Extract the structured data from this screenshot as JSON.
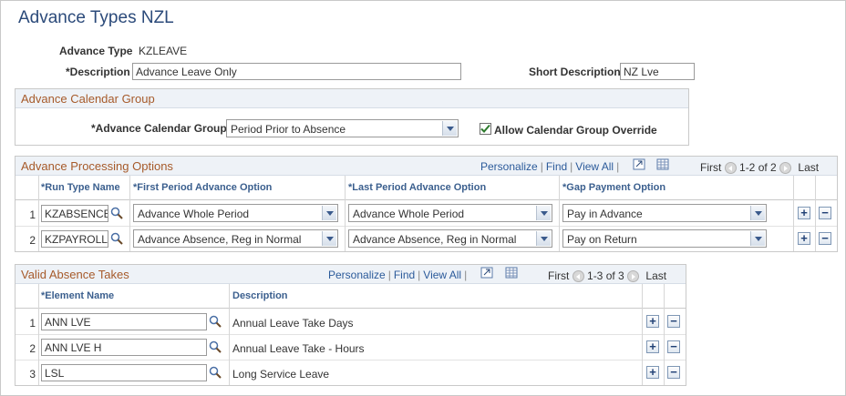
{
  "page": {
    "title": "Advance Types NZL"
  },
  "header": {
    "advance_type_label": "Advance Type",
    "advance_type_value": "KZLEAVE",
    "description_label": "*Description",
    "description_value": "Advance Leave Only",
    "short_description_label": "Short Description",
    "short_description_value": "NZ Lve"
  },
  "calendar_group": {
    "section_title": "Advance Calendar Group",
    "field_label": "*Advance Calendar Group",
    "selected": "Period Prior to Absence",
    "override_label": "Allow Calendar Group Override",
    "override_checked": true
  },
  "processing": {
    "section_title": "Advance Processing Options",
    "nav": {
      "personalize": "Personalize",
      "find": "Find",
      "view_all": "View All",
      "first": "First",
      "range": "1-2 of 2",
      "last": "Last"
    },
    "columns": {
      "run_type": "*Run Type Name",
      "first_period": "*First Period Advance Option",
      "last_period": "*Last Period Advance Option",
      "gap_payment": "*Gap Payment Option"
    },
    "rows": [
      {
        "num": "1",
        "run_type": "KZABSENCE",
        "first_period": "Advance Whole Period",
        "last_period": "Advance Whole Period",
        "gap_payment": "Pay in Advance"
      },
      {
        "num": "2",
        "run_type": "KZPAYROLL",
        "first_period": "Advance Absence, Reg in Normal",
        "last_period": "Advance Absence, Reg in Normal",
        "gap_payment": "Pay on Return"
      }
    ]
  },
  "absence_takes": {
    "section_title": "Valid Absence Takes",
    "nav": {
      "personalize": "Personalize",
      "find": "Find",
      "view_all": "View All",
      "first": "First",
      "range": "1-3 of 3",
      "last": "Last"
    },
    "columns": {
      "element_name": "*Element Name",
      "description": "Description"
    },
    "rows": [
      {
        "num": "1",
        "element_name": "ANN LVE",
        "description": "Annual Leave Take Days"
      },
      {
        "num": "2",
        "element_name": "ANN LVE H",
        "description": "Annual Leave Take - Hours"
      },
      {
        "num": "3",
        "element_name": "LSL",
        "description": "Long Service Leave"
      }
    ]
  },
  "buttons": {
    "add": "+",
    "remove": "−"
  }
}
